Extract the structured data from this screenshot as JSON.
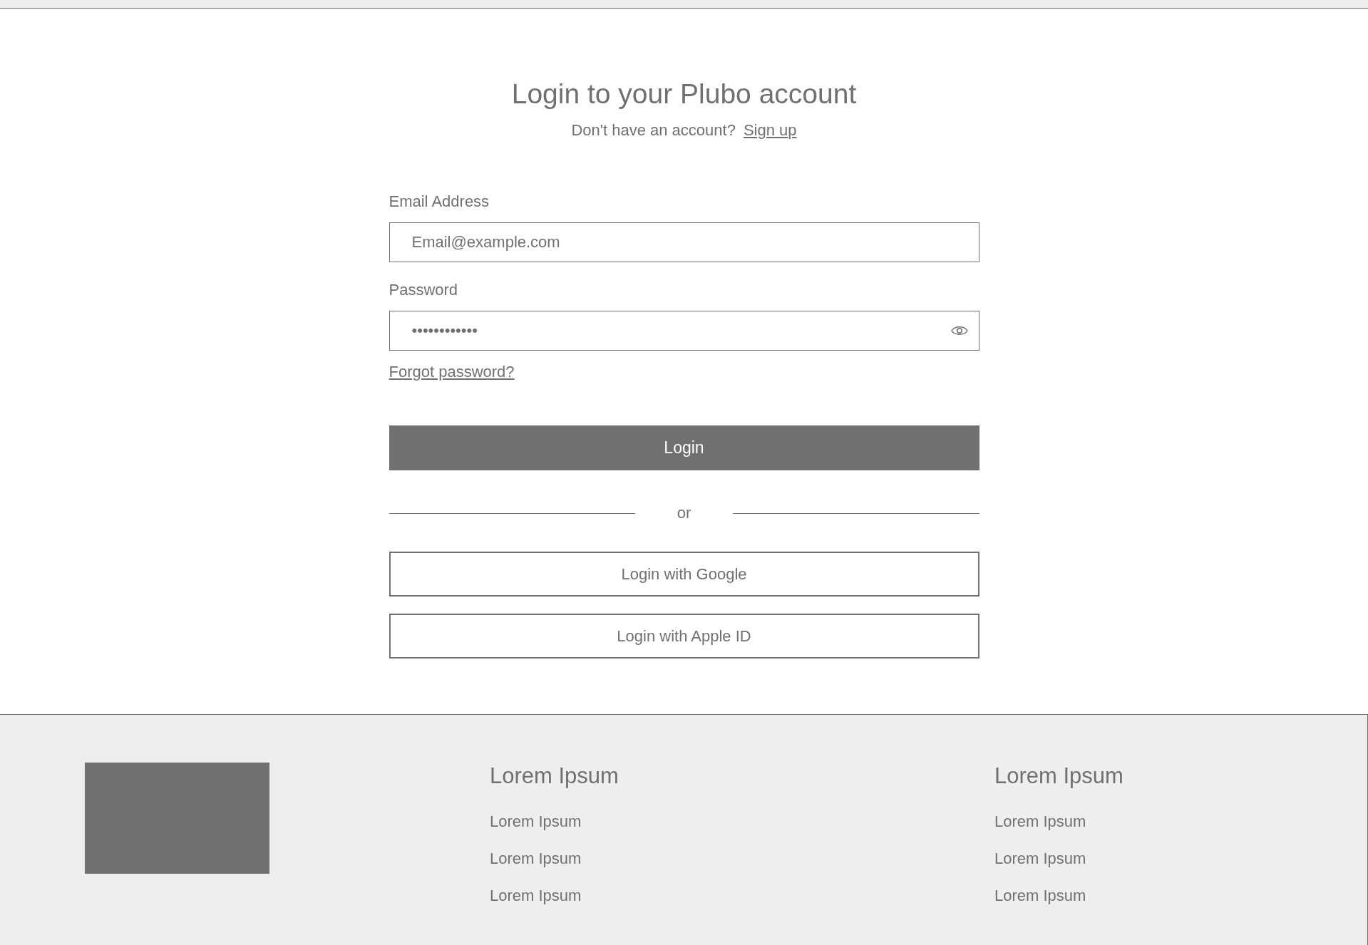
{
  "header": {
    "title": "Login to your Plubo account",
    "prompt": "Don't have an account?",
    "signup_link": "Sign up"
  },
  "form": {
    "email": {
      "label": "Email Address",
      "placeholder": "Email@example.com"
    },
    "password": {
      "label": "Password",
      "value": "••••••••••••"
    },
    "forgot_link": "Forgot password?",
    "login_button": "Login",
    "divider": "or",
    "social_buttons": [
      "Login with Google",
      "Login with Apple ID"
    ]
  },
  "footer": {
    "columns": [
      {
        "heading": "Lorem Ipsum",
        "links": [
          "Lorem Ipsum",
          "Lorem Ipsum",
          "Lorem Ipsum"
        ]
      },
      {
        "heading": "Lorem Ipsum",
        "links": [
          "Lorem Ipsum",
          "Lorem Ipsum",
          "Lorem Ipsum"
        ]
      }
    ]
  }
}
